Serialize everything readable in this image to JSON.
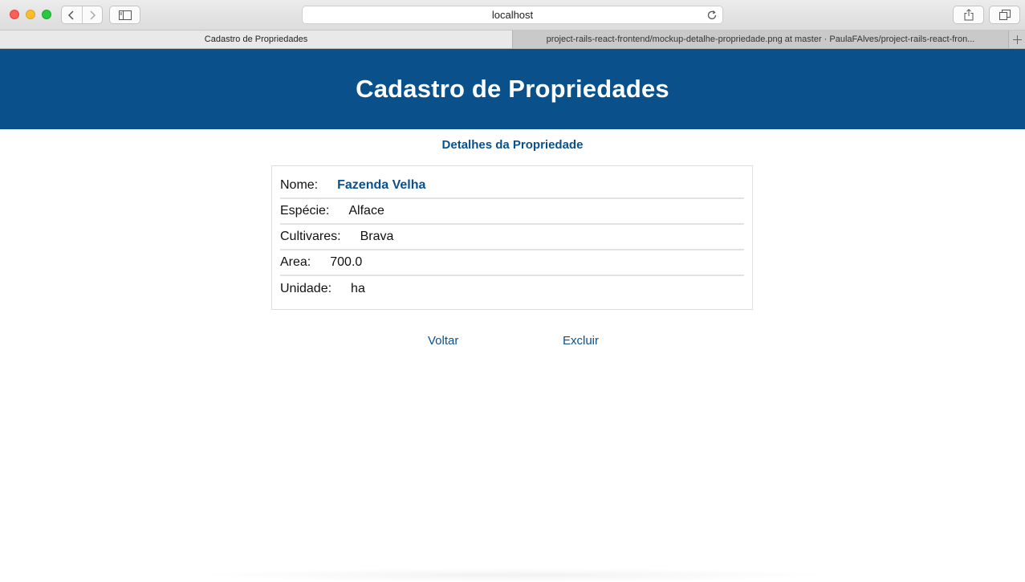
{
  "browser": {
    "address": "localhost",
    "tabs": [
      {
        "label": "Cadastro de Propriedades"
      },
      {
        "label": "project-rails-react-frontend/mockup-detalhe-propriedade.png at master · PaulaFAlves/project-rails-react-fron..."
      }
    ]
  },
  "page": {
    "title": "Cadastro de Propriedades",
    "subtitle": "Detalhes da Propriedade",
    "fields": [
      {
        "label": "Nome:",
        "value": "Fazenda Velha"
      },
      {
        "label": "Espécie:",
        "value": "Alface"
      },
      {
        "label": "Cultivares:",
        "value": "Brava"
      },
      {
        "label": "Area:",
        "value": "700.0"
      },
      {
        "label": "Unidade:",
        "value": "ha"
      }
    ],
    "actions": {
      "back_label": "Voltar",
      "delete_label": "Excluir"
    }
  },
  "colors": {
    "brand": "#0a518b",
    "background": "#ffffff"
  }
}
